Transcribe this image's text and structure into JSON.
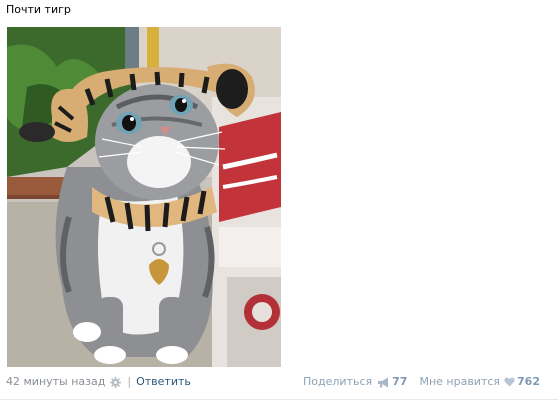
{
  "post": {
    "title": "Почти тигр",
    "photo_alt": "cat-in-tiger-costume-photo"
  },
  "footer": {
    "timestamp": "42 минуты назад",
    "separator": "|",
    "reply_label": "Ответить",
    "share_label": "Поделиться",
    "share_count": "77",
    "like_label": "Мне нравится",
    "like_count": "762"
  },
  "colors": {
    "link": "#2b587a",
    "muted": "#8a8f96",
    "counter": "#7f98b3"
  },
  "icons": {
    "settings": "gear-icon",
    "share": "megaphone-icon",
    "like": "heart-icon"
  }
}
